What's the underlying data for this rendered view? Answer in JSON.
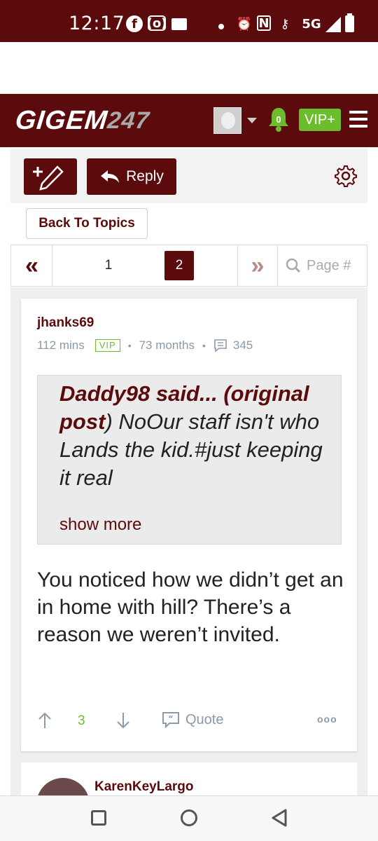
{
  "status_bar": {
    "time": "12:17",
    "network": "5G",
    "icons": [
      "facebook-icon",
      "radio-icon",
      "mail-icon",
      "dot-icon",
      "alarm-icon",
      "nfc-icon",
      "key-icon",
      "signal-icon",
      "battery-icon"
    ]
  },
  "header": {
    "logo_main": "GIGEM",
    "logo_num": "247",
    "notification_count": "0",
    "vip_label": "VIP+"
  },
  "toolbar": {
    "reply_label": "Reply"
  },
  "back_label": "Back To Topics",
  "pagination": {
    "first": "«",
    "last": "»",
    "pages": [
      "1",
      "2"
    ],
    "current": "2",
    "search_placeholder": "Page #"
  },
  "post": {
    "username": "jhanks69",
    "time_ago": "112 mins",
    "badge": "VIP",
    "member_for": "73 months",
    "post_count": "345",
    "quote": {
      "author": "Daddy98 said...",
      "open_paren": " (",
      "original_post": "original post",
      "close_paren": ")",
      "text": " NoOur staff isn't who Lands the kid.#just keeping it real"
    },
    "show_more": "show more",
    "body": "You noticed how we didn’t get an in home with hill? There’s a reason we weren’t invited.",
    "upvotes": "3",
    "quote_label": "Quote",
    "more_label": "ooo"
  },
  "next_post": {
    "username": "KarenKeyLargo"
  },
  "colors": {
    "brand": "#5b0b0b",
    "accent_green": "#6bbd2e",
    "meta_gray": "#8a9aa8"
  }
}
